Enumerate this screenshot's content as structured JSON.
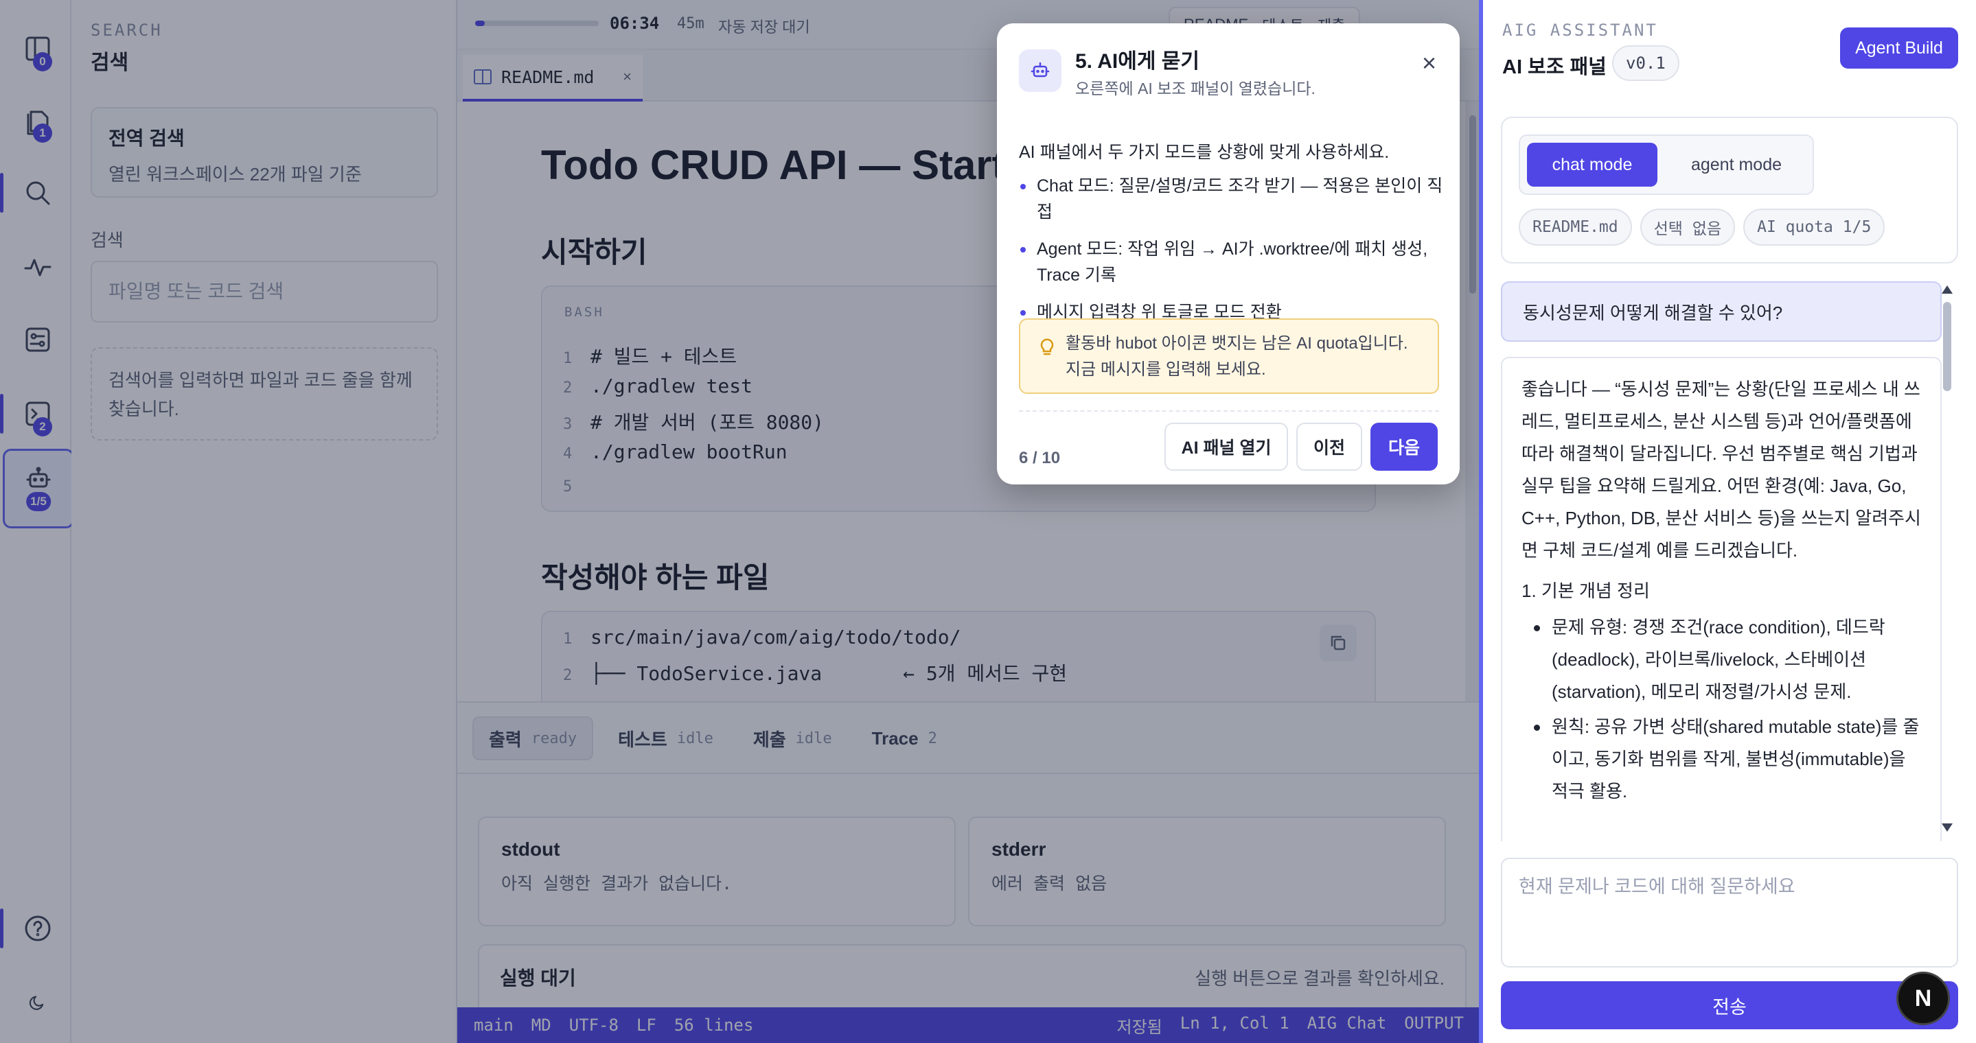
{
  "activity_bar": {
    "explorer_badge": "0",
    "files_badge": "1",
    "terminal_badge": "2",
    "ai_badge": "1/5"
  },
  "side": {
    "kicker": "SEARCH",
    "title": "검색",
    "global_title": "전역 검색",
    "global_sub": "열린 워크스페이스 22개 파일 기준",
    "search_label": "검색",
    "search_placeholder": "파일명 또는 코드 검색",
    "hint": "검색어를 입력하면 파일과 코드 줄을 함께 찾습니다."
  },
  "topstrip": {
    "progress": 0.08,
    "timer": "06:34",
    "duration": "45m",
    "autosave": "자동 저장 대기",
    "tabs": [
      "README",
      "테스트",
      "제출"
    ]
  },
  "tab": {
    "name": "README.md",
    "close": "×"
  },
  "doc": {
    "title": "Todo CRUD API — Starter",
    "h2_start": "시작하기",
    "code1_lang": "BASH",
    "code1": [
      {
        "n": "1",
        "t": "# 빌드 + 테스트"
      },
      {
        "n": "2",
        "t": "./gradlew test"
      },
      {
        "n": "3",
        "t": "# 개발 서버 (포트 8080)"
      },
      {
        "n": "4",
        "t": "./gradlew bootRun"
      },
      {
        "n": "5",
        "t": ""
      }
    ],
    "h2_files": "작성해야 하는 파일",
    "code2": [
      {
        "n": "1",
        "t": "src/main/java/com/aig/todo/todo/"
      },
      {
        "n": "2",
        "t": "├── TodoService.java       ← 5개 메서드 구현"
      }
    ]
  },
  "bottom": {
    "tabs": [
      {
        "label": "출력",
        "status": "ready"
      },
      {
        "label": "테스트",
        "status": "idle"
      },
      {
        "label": "제출",
        "status": "idle"
      },
      {
        "label": "Trace",
        "status": "2"
      }
    ],
    "stdout_title": "stdout",
    "stdout_text": "아직 실행한 결과가 없습니다.",
    "stderr_title": "stderr",
    "stderr_text": "에러 출력 없음",
    "run_title": "실행 대기",
    "run_hint": "실행 버튼으로 결과를 확인하세요."
  },
  "statusbar": {
    "left": [
      "main",
      "MD",
      "UTF-8",
      "LF",
      "56 lines"
    ],
    "right": [
      "저장됨",
      "Ln 1, Col 1",
      "AIG Chat",
      "OUTPUT"
    ]
  },
  "popup": {
    "title": "5. AI에게 묻기",
    "subtitle": "오른쪽에 AI 보조 패널이 열렸습니다.",
    "close": "×",
    "intro": "AI 패널에서 두 가지 모드를 상황에 맞게 사용하세요.",
    "bullets": [
      "Chat 모드: 질문/설명/코드 조각 받기 — 적용은 본인이 직접",
      "Agent 모드: 작업 위임 → AI가 .worktree/에 패치 생성, Trace 기록",
      "메시지 입력창 위 토글로 모드 전환"
    ],
    "tip": "활동바 hubot 아이콘 뱃지는 남은 AI quota입니다. 지금 메시지를 입력해 보세요.",
    "step": "6 / 10",
    "btn_open": "AI 패널 열기",
    "btn_prev": "이전",
    "btn_next": "다음"
  },
  "assistant": {
    "kicker": "AIG ASSISTANT",
    "title": "AI 보조 패널",
    "version": "v0.1",
    "agent_build": "Agent Build",
    "mode_on": "chat mode",
    "mode_off": "agent mode",
    "chips": [
      "README.md",
      "선택 없음",
      "AI quota 1/5"
    ],
    "user_msg": "동시성문제 어떻게 해결할 수 있어?",
    "ai_para": "좋습니다 — “동시성 문제”는 상황(단일 프로세스 내 쓰레드, 멀티프로세스, 분산 시스템 등)과 언어/플랫폼에 따라 해결책이 달라집니다. 우선 범주별로 핵심 기법과 실무 팁을 요약해 드릴게요. 어떤 환경(예: Java, Go, C++, Python, DB, 분산 서비스 등)을 쓰는지 알려주시면 구체 코드/설계 예를 드리겠습니다.",
    "ai_ol": "1. 기본 개념 정리",
    "ai_bullets": [
      "문제 유형: 경쟁 조건(race condition), 데드락(deadlock), 라이브록/livelock, 스타베이션(starvation), 메모리 재정렬/가시성 문제.",
      "원칙: 공유 가변 상태(shared mutable state)를 줄이고, 동기화 범위를 작게, 불변성(immutable)을 적극 활용."
    ],
    "input_placeholder": "현재 문제나 코드에 대해 질문하세요",
    "send": "전송",
    "logo": "N"
  }
}
